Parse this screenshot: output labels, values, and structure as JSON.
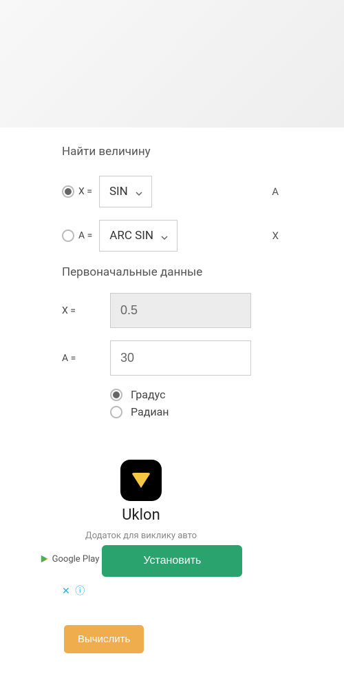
{
  "section_find": "Найти величину",
  "row1": {
    "var": "X =",
    "select": "SIN",
    "right": "A"
  },
  "row2": {
    "var": "A =",
    "select": "ARC SIN",
    "right": "X"
  },
  "section_data": "Первоначальные данные",
  "input_x": {
    "label": "X =",
    "value": "0.5"
  },
  "input_a": {
    "label": "A =",
    "value": "30"
  },
  "units": {
    "deg": "Градус",
    "rad": "Радиан"
  },
  "ad": {
    "name": "Uklon",
    "desc": "Додаток для виклику авто",
    "gplay": "Google Play",
    "install": "Установить"
  },
  "calc_button": "Вычислить"
}
